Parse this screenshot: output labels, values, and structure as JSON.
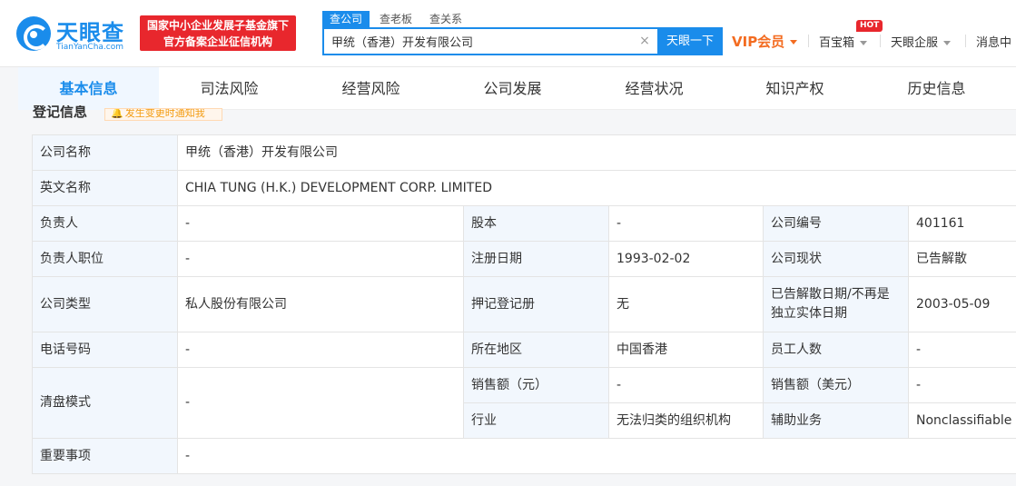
{
  "header": {
    "logo_name": "天眼查",
    "logo_sub": "TianYanCha.com",
    "fund_badge_line1": "国家中小企业发展子基金旗下",
    "fund_badge_line2": "官方备案企业征信机构",
    "search_tabs": [
      "查公司",
      "查老板",
      "查关系"
    ],
    "search_value": "甲统（香港）开发有限公司",
    "search_button": "天眼一下",
    "vip": "VIP会员",
    "baibaoxiang": "百宝箱",
    "hot": "HOT",
    "enterprise_service": "天眼企服",
    "messages": "消息中"
  },
  "tabs": [
    "基本信息",
    "司法风险",
    "经营风险",
    "公司发展",
    "经营状况",
    "知识产权",
    "历史信息"
  ],
  "section": {
    "title": "登记信息",
    "notify": "发生变更时通知我"
  },
  "info": {
    "company_name_label": "公司名称",
    "company_name": "甲统（香港）开发有限公司",
    "english_name_label": "英文名称",
    "english_name": "CHIA TUNG (H.K.) DEVELOPMENT CORP. LIMITED",
    "person_label": "负责人",
    "person": "-",
    "capital_label": "股本",
    "capital": "-",
    "company_no_label": "公司编号",
    "company_no": "401161",
    "person_position_label": "负责人职位",
    "person_position": "-",
    "reg_date_label": "注册日期",
    "reg_date": "1993-02-02",
    "status_label": "公司现状",
    "status": "已告解散",
    "type_label": "公司类型",
    "type": "私人股份有限公司",
    "charge_label": "押记登记册",
    "charge": "无",
    "dissolve_label": "已告解散日期/不再是独立实体日期",
    "dissolve": "2003-05-09",
    "phone_label": "电话号码",
    "phone": "-",
    "region_label": "所在地区",
    "region": "中国香港",
    "staff_label": "员工人数",
    "staff": "-",
    "liquidation_label": "清盘模式",
    "liquidation": "-",
    "sales_cny_label": "销售额（元）",
    "sales_cny": "-",
    "sales_usd_label": "销售额（美元）",
    "sales_usd": "-",
    "industry_label": "行业",
    "industry": "无法归类的组织机构",
    "aux_label": "辅助业务",
    "aux": "Nonclassifiable es",
    "important_label": "重要事项",
    "important": "-"
  }
}
